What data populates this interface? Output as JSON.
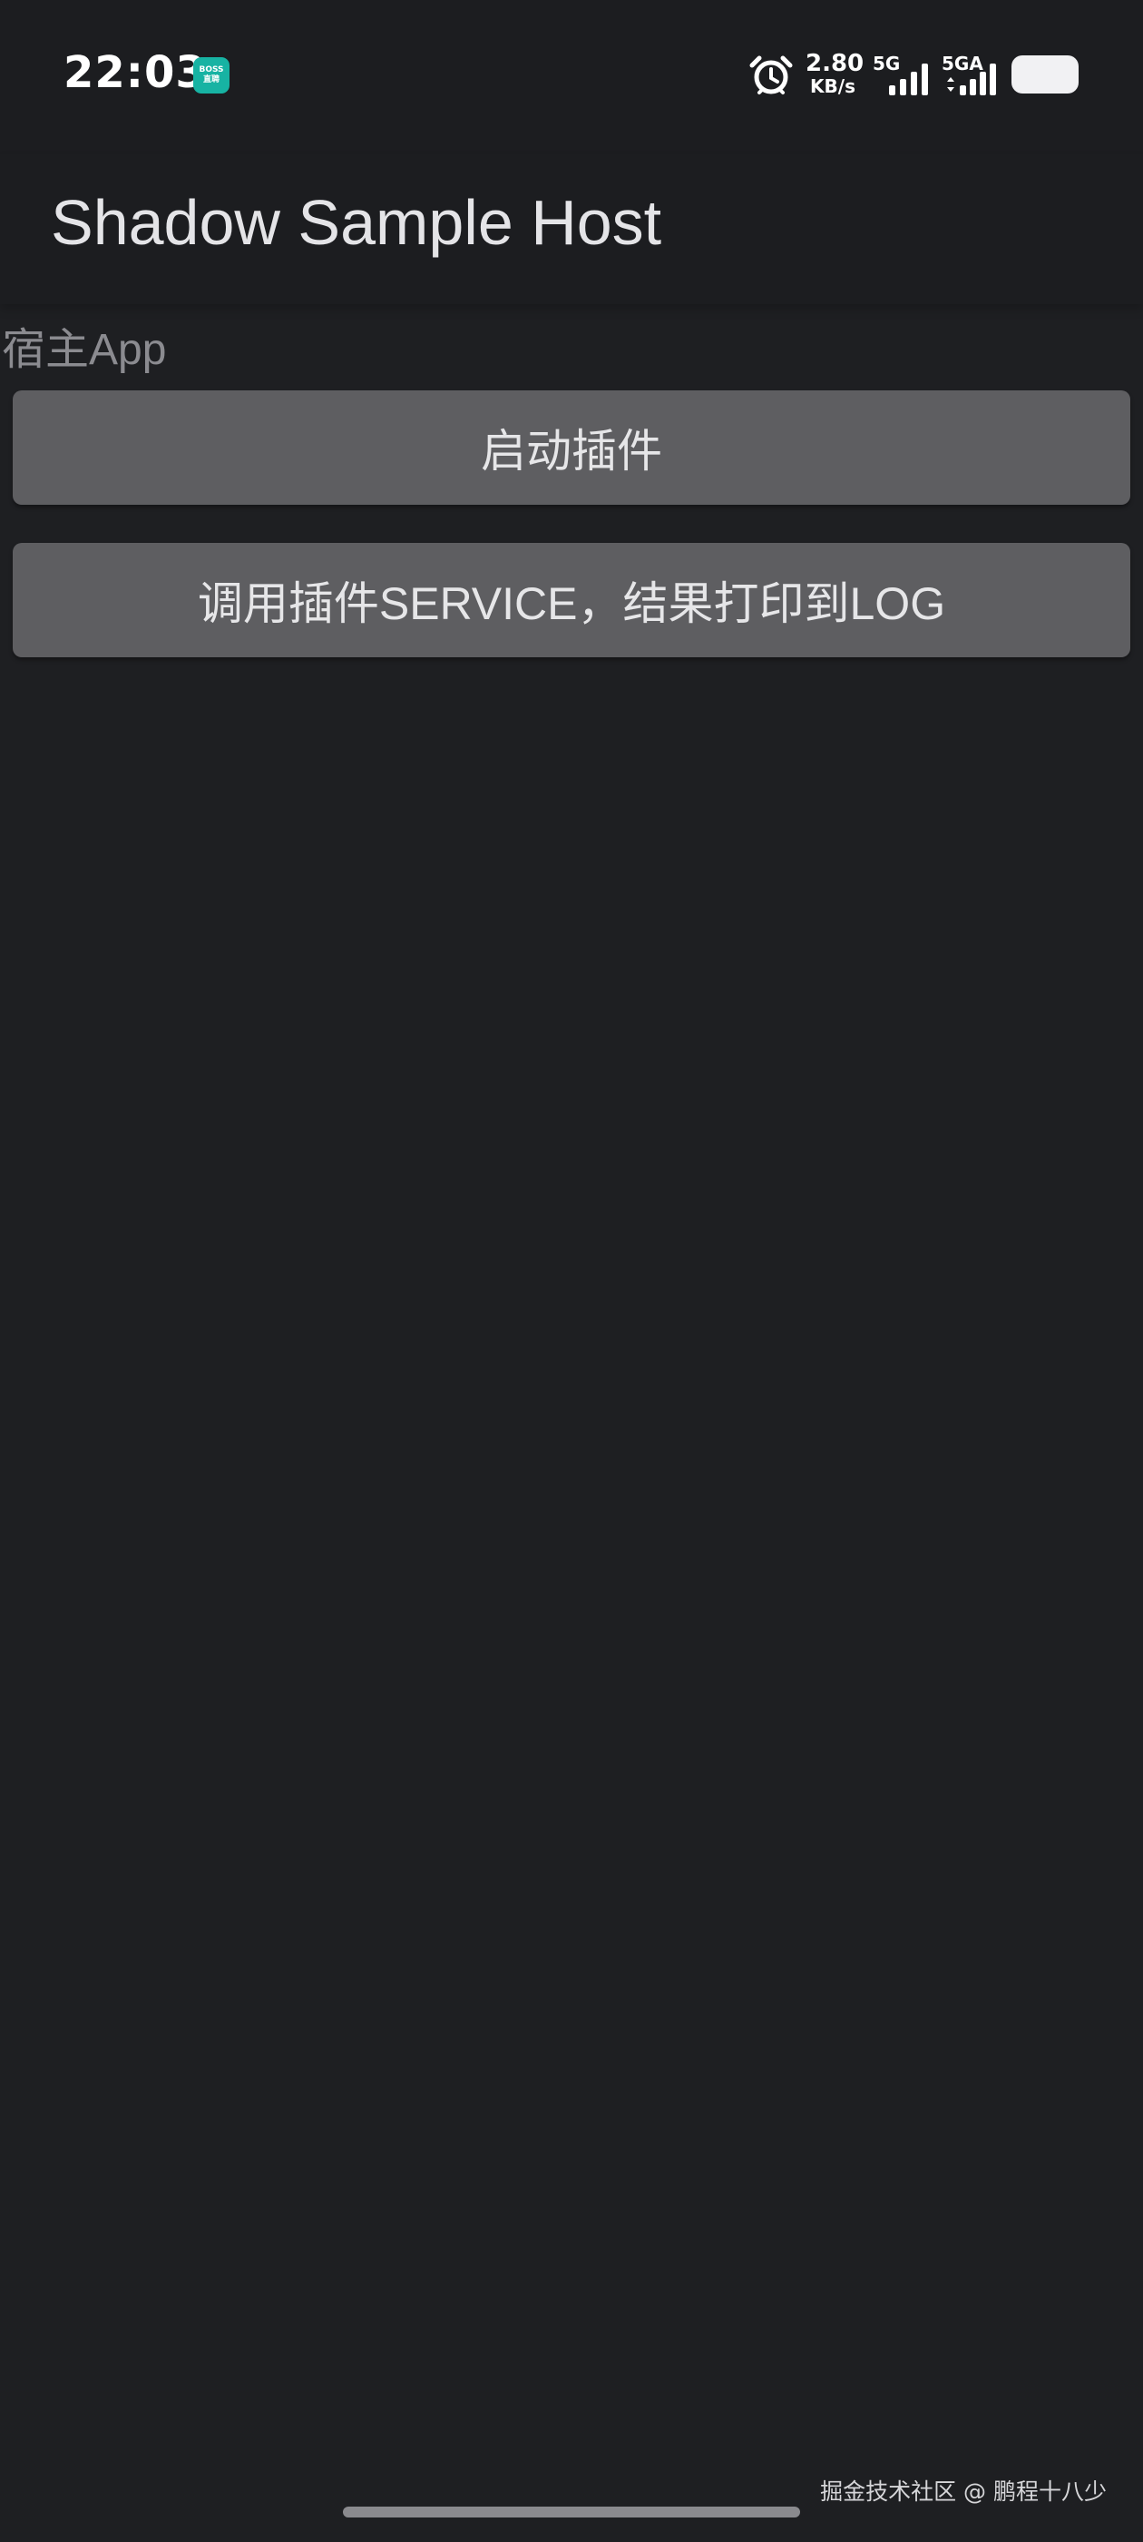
{
  "status_bar": {
    "time": "22:03",
    "app_badge_line1": "BOSS",
    "app_badge_line2": "直聘",
    "alarm_icon": "alarm-clock-icon",
    "net_speed_value": "2.80",
    "net_speed_unit": "KB/s",
    "sim1_label": "5G",
    "sim2_label": "5GA",
    "battery_icon": "battery-icon"
  },
  "action_bar": {
    "title": "Shadow Sample Host"
  },
  "main": {
    "label": "宿主App",
    "start_plugin_button": "启动插件",
    "call_service_button": "调用插件SERVICE，结果打印到LOG"
  },
  "watermark": "掘金技术社区 @ 鹏程十八少",
  "colors": {
    "background": "#1e1f22",
    "button": "#5e5e61",
    "badge": "#17b3a3"
  }
}
